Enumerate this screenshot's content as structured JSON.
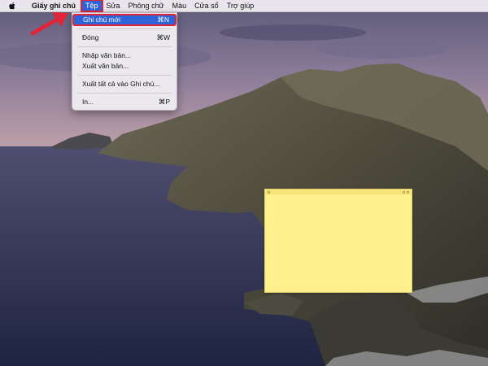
{
  "menubar": {
    "app_name": "Giấy ghi chú",
    "menus": [
      "Tệp",
      "Sửa",
      "Phông chữ",
      "Màu",
      "Cửa sổ",
      "Trợ giúp"
    ],
    "active_menu": "Tệp"
  },
  "file_menu": {
    "new_note": {
      "label": "Ghi chú mới",
      "shortcut": "⌘N"
    },
    "close": {
      "label": "Đóng",
      "shortcut": "⌘W"
    },
    "import_text": {
      "label": "Nhập văn bản..."
    },
    "export_text": {
      "label": "Xuất văn bản..."
    },
    "export_all_notes": {
      "label": "Xuất tất cả vào Ghi chú..."
    },
    "print": {
      "label": "In...",
      "shortcut": "⌘P"
    }
  },
  "colors": {
    "highlight": "#2f63d8",
    "annotation_red": "#e0243a",
    "note_yellow": "#fff08e"
  },
  "icons": {
    "apple": "apple-logo-icon",
    "arrow": "red-pointer-arrow-icon"
  }
}
